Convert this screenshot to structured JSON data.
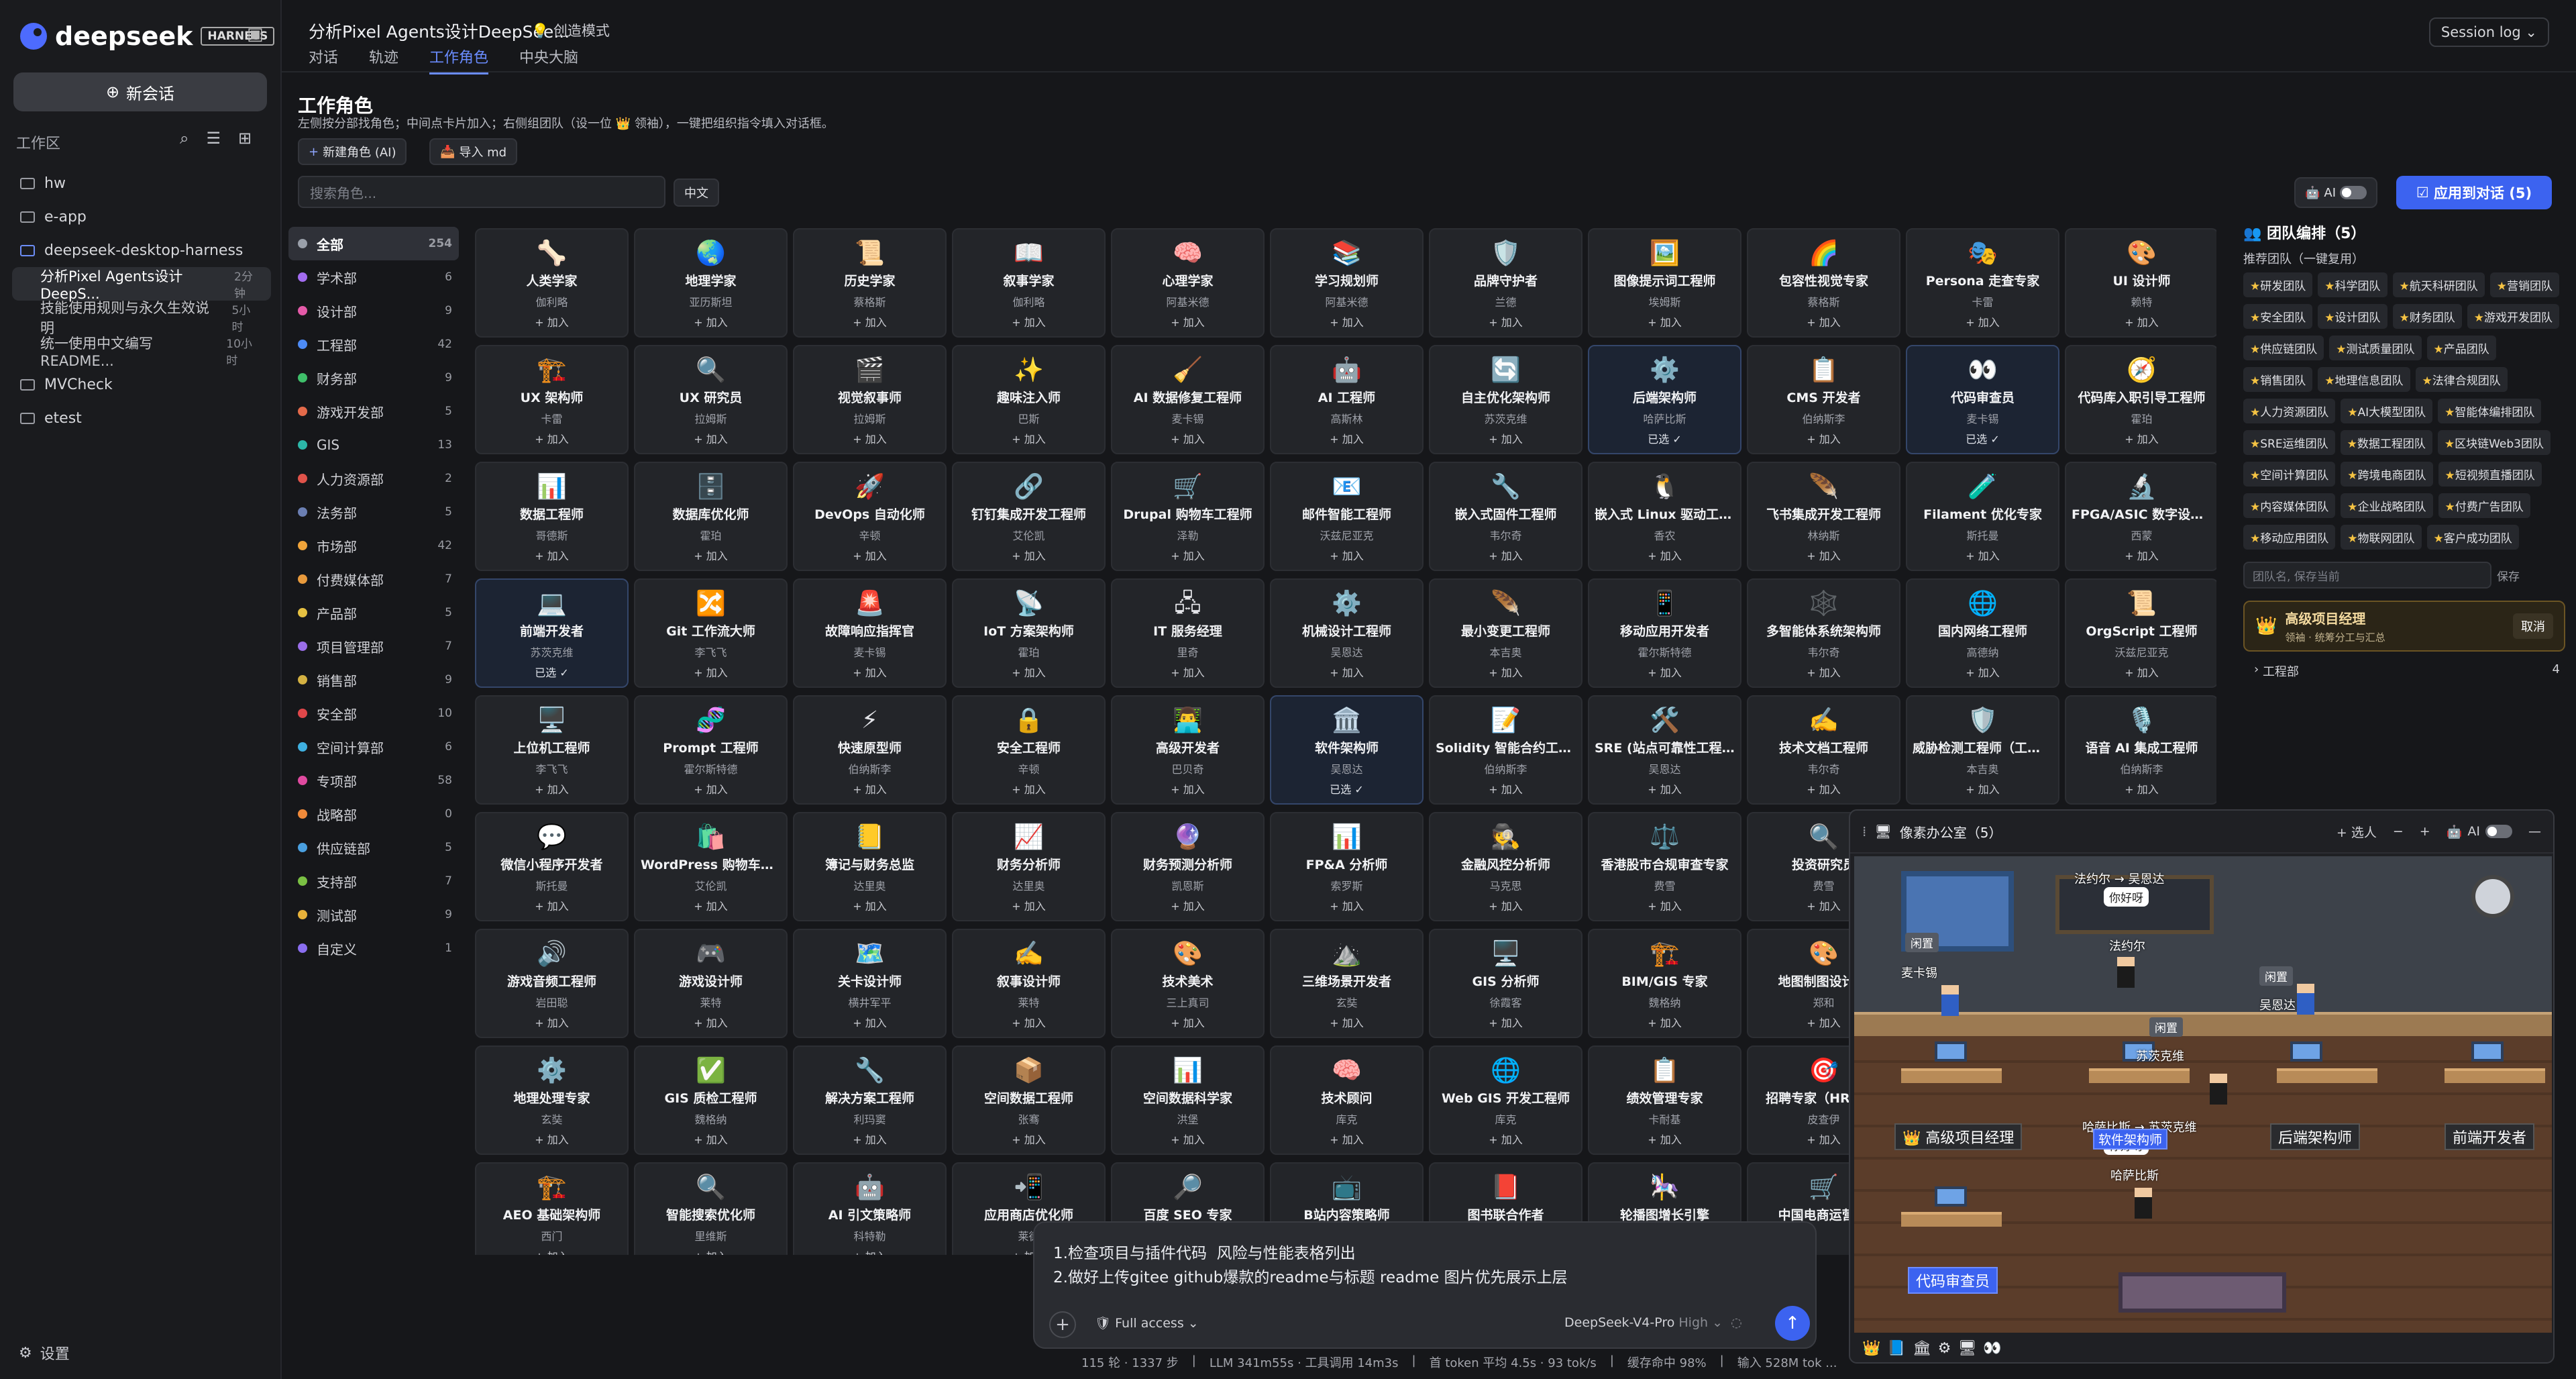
{
  "sidebar": {
    "brand": "deepseek",
    "badge": "HARNESS",
    "new_chat": "新会话",
    "workspace_label": "工作区",
    "tree": [
      {
        "label": "hw",
        "type": "folder"
      },
      {
        "label": "e-app",
        "type": "folder"
      },
      {
        "label": "deepseek-desktop-harness",
        "type": "folder-open"
      },
      {
        "label": "分析Pixel Agents设计DeepS...",
        "age": "2分钟",
        "type": "child",
        "active": true
      },
      {
        "label": "技能使用规则与永久生效说明",
        "age": "5小时",
        "type": "child"
      },
      {
        "label": "统一使用中文编写README...",
        "age": "10小时",
        "type": "child"
      },
      {
        "label": "MVCheck",
        "type": "folder"
      },
      {
        "label": "etest",
        "type": "folder"
      }
    ],
    "settings": "设置"
  },
  "header": {
    "title": "分析Pixel Agents设计DeepSee...",
    "mode": "创造模式",
    "session": "Session log",
    "tabs": [
      {
        "label": "对话"
      },
      {
        "label": "轨迹"
      },
      {
        "label": "工作角色",
        "active": true
      },
      {
        "label": "中央大脑"
      }
    ]
  },
  "page": {
    "title": "工作角色",
    "subtitle": "左侧按分部找角色；中间点卡片加入；右侧组团队（设一位 👑 领袖），一键把组织指令填入对话框。",
    "new_role": "新建角色 (AI)",
    "import": "导入 md",
    "search_placeholder": "搜索角色...",
    "lang": "中文",
    "ai": "AI",
    "apply": "应用到对话 (5)"
  },
  "departments": [
    {
      "label": "全部",
      "count": "254",
      "color": "#9aa0aa",
      "active": true
    },
    {
      "label": "学术部",
      "count": "6",
      "color": "#a36cf0"
    },
    {
      "label": "设计部",
      "count": "9",
      "color": "#e45aa8"
    },
    {
      "label": "工程部",
      "count": "42",
      "color": "#4d8bf5"
    },
    {
      "label": "财务部",
      "count": "9",
      "color": "#3fbf6a"
    },
    {
      "label": "游戏开发部",
      "count": "5",
      "color": "#e46a4a"
    },
    {
      "label": "GIS",
      "count": "13",
      "color": "#2cb7a8"
    },
    {
      "label": "人力资源部",
      "count": "2",
      "color": "#e0534a"
    },
    {
      "label": "法务部",
      "count": "5",
      "color": "#6b7fb3"
    },
    {
      "label": "市场部",
      "count": "42",
      "color": "#f0a43a"
    },
    {
      "label": "付费媒体部",
      "count": "7",
      "color": "#e89a3c"
    },
    {
      "label": "产品部",
      "count": "5",
      "color": "#e6c142"
    },
    {
      "label": "项目管理部",
      "count": "7",
      "color": "#9a6ee8"
    },
    {
      "label": "销售部",
      "count": "9",
      "color": "#d4b142"
    },
    {
      "label": "安全部",
      "count": "10",
      "color": "#e0474a"
    },
    {
      "label": "空间计算部",
      "count": "6",
      "color": "#3fb0e0"
    },
    {
      "label": "专项部",
      "count": "58",
      "color": "#e04aa0"
    },
    {
      "label": "战略部",
      "count": "0",
      "color": "#f08a3a"
    },
    {
      "label": "供应链部",
      "count": "5",
      "color": "#4aa0e0"
    },
    {
      "label": "支持部",
      "count": "7",
      "color": "#7ac043"
    },
    {
      "label": "测试部",
      "count": "9",
      "color": "#e8b23a"
    },
    {
      "label": "自定义",
      "count": "1",
      "color": "#8a6ef0"
    }
  ],
  "cards": [
    {
      "icon": "🦴",
      "name": "人类学家",
      "person": "伽利略",
      "add": "+ 加入"
    },
    {
      "icon": "🌏",
      "name": "地理学家",
      "person": "亚历斯坦",
      "add": "+ 加入"
    },
    {
      "icon": "📜",
      "name": "历史学家",
      "person": "蔡格斯",
      "add": "+ 加入"
    },
    {
      "icon": "📖",
      "name": "叙事学家",
      "person": "伽利略",
      "add": "+ 加入"
    },
    {
      "icon": "🧠",
      "name": "心理学家",
      "person": "阿基米德",
      "add": "+ 加入"
    },
    {
      "icon": "📚",
      "name": "学习规划师",
      "person": "阿基米德",
      "add": "+ 加入"
    },
    {
      "icon": "🛡️",
      "name": "品牌守护者",
      "person": "兰德",
      "add": "+ 加入"
    },
    {
      "icon": "🖼️",
      "name": "图像提示词工程师",
      "person": "埃姆斯",
      "add": "+ 加入"
    },
    {
      "icon": "🌈",
      "name": "包容性视觉专家",
      "person": "蔡格斯",
      "add": "+ 加入"
    },
    {
      "icon": "🎭",
      "name": "Persona 走查专家",
      "person": "卡雷",
      "add": "+ 加入"
    },
    {
      "icon": "🎨",
      "name": "UI 设计师",
      "person": "赖特",
      "add": "+ 加入"
    },
    {
      "icon": "🏗️",
      "name": "UX 架构师",
      "person": "卡雷",
      "add": "+ 加入"
    },
    {
      "icon": "🔍",
      "name": "UX 研究员",
      "person": "拉姆斯",
      "add": "+ 加入"
    },
    {
      "icon": "🎬",
      "name": "视觉叙事师",
      "person": "拉姆斯",
      "add": "+ 加入"
    },
    {
      "icon": "✨",
      "name": "趣味注入师",
      "person": "巴斯",
      "add": "+ 加入"
    },
    {
      "icon": "🧹",
      "name": "AI 数据修复工程师",
      "person": "麦卡锡",
      "add": "+ 加入"
    },
    {
      "icon": "🤖",
      "name": "AI 工程师",
      "person": "高斯林",
      "add": "+ 加入"
    },
    {
      "icon": "🔄",
      "name": "自主优化架构师",
      "person": "苏茨克维",
      "add": "+ 加入"
    },
    {
      "icon": "⚙️",
      "name": "后端架构师",
      "person": "哈萨比斯",
      "add": "已选 ✓",
      "sel": true
    },
    {
      "icon": "📋",
      "name": "CMS 开发者",
      "person": "伯纳斯李",
      "add": "+ 加入"
    },
    {
      "icon": "👀",
      "name": "代码审查员",
      "person": "麦卡锡",
      "add": "已选 ✓",
      "sel": true
    },
    {
      "icon": "🧭",
      "name": "代码库入职引导工程师",
      "person": "霍珀",
      "add": "+ 加入"
    },
    {
      "icon": "📊",
      "name": "数据工程师",
      "person": "哥德斯",
      "add": "+ 加入"
    },
    {
      "icon": "🗄️",
      "name": "数据库优化师",
      "person": "霍珀",
      "add": "+ 加入"
    },
    {
      "icon": "🚀",
      "name": "DevOps 自动化师",
      "person": "辛顿",
      "add": "+ 加入"
    },
    {
      "icon": "🔗",
      "name": "钉钉集成开发工程师",
      "person": "艾伦凯",
      "add": "+ 加入"
    },
    {
      "icon": "🛒",
      "name": "Drupal 购物车工程师",
      "person": "泽勒",
      "add": "+ 加入"
    },
    {
      "icon": "📧",
      "name": "邮件智能工程师",
      "person": "沃兹尼亚克",
      "add": "+ 加入"
    },
    {
      "icon": "🔧",
      "name": "嵌入式固件工程师",
      "person": "韦尔奇",
      "add": "+ 加入"
    },
    {
      "icon": "🐧",
      "name": "嵌入式 Linux 驱动工程师",
      "person": "香农",
      "add": "+ 加入"
    },
    {
      "icon": "🪶",
      "name": "飞书集成开发工程师",
      "person": "林纳斯",
      "add": "+ 加入"
    },
    {
      "icon": "🧪",
      "name": "Filament 优化专家",
      "person": "斯托曼",
      "add": "+ 加入"
    },
    {
      "icon": "🔬",
      "name": "FPGA/ASIC 数字设计...",
      "person": "西蒙",
      "add": "+ 加入"
    },
    {
      "icon": "💻",
      "name": "前端开发者",
      "person": "苏茨克维",
      "add": "已选 ✓",
      "sel": true
    },
    {
      "icon": "🔀",
      "name": "Git 工作流大师",
      "person": "李飞飞",
      "add": "+ 加入"
    },
    {
      "icon": "🚨",
      "name": "故障响应指挥官",
      "person": "麦卡锡",
      "add": "+ 加入"
    },
    {
      "icon": "📡",
      "name": "IoT 方案架构师",
      "person": "霍珀",
      "add": "+ 加入"
    },
    {
      "icon": "🖧",
      "name": "IT 服务经理",
      "person": "里奇",
      "add": "+ 加入"
    },
    {
      "icon": "⚙️",
      "name": "机械设计工程师",
      "person": "吴恩达",
      "add": "+ 加入"
    },
    {
      "icon": "🪶",
      "name": "最小变更工程师",
      "person": "本吉奥",
      "add": "+ 加入"
    },
    {
      "icon": "📱",
      "name": "移动应用开发者",
      "person": "霍尔斯特德",
      "add": "+ 加入"
    },
    {
      "icon": "🕸️",
      "name": "多智能体系统架构师",
      "person": "韦尔奇",
      "add": "+ 加入"
    },
    {
      "icon": "🌐",
      "name": "国内网络工程师",
      "person": "高德纳",
      "add": "+ 加入"
    },
    {
      "icon": "📜",
      "name": "OrgScript 工程师",
      "person": "沃兹尼亚克",
      "add": "+ 加入"
    },
    {
      "icon": "🖥️",
      "name": "上位机工程师",
      "person": "李飞飞",
      "add": "+ 加入"
    },
    {
      "icon": "🧬",
      "name": "Prompt 工程师",
      "person": "霍尔斯特德",
      "add": "+ 加入"
    },
    {
      "icon": "⚡",
      "name": "快速原型师",
      "person": "伯纳斯李",
      "add": "+ 加入"
    },
    {
      "icon": "🔒",
      "name": "安全工程师",
      "person": "辛顿",
      "add": "+ 加入"
    },
    {
      "icon": "👨‍💻",
      "name": "高级开发者",
      "person": "巴贝奇",
      "add": "+ 加入"
    },
    {
      "icon": "🏛️",
      "name": "软件架构师",
      "person": "吴恩达",
      "add": "已选 ✓",
      "sel": true
    },
    {
      "icon": "📝",
      "name": "Solidity 智能合约工程师",
      "person": "伯纳斯李",
      "add": "+ 加入"
    },
    {
      "icon": "🛠️",
      "name": "SRE (站点可靠性工程师)",
      "person": "吴恩达",
      "add": "+ 加入"
    },
    {
      "icon": "✍️",
      "name": "技术文档工程师",
      "person": "韦尔奇",
      "add": "+ 加入"
    },
    {
      "icon": "🛡️",
      "name": "威胁检测工程师（工程...",
      "person": "本吉奥",
      "add": "+ 加入"
    },
    {
      "icon": "🎙️",
      "name": "语音 AI 集成工程师",
      "person": "伯纳斯李",
      "add": "+ 加入"
    },
    {
      "icon": "💬",
      "name": "微信小程序开发者",
      "person": "斯托曼",
      "add": "+ 加入"
    },
    {
      "icon": "🛍️",
      "name": "WordPress 购物车工程...",
      "person": "艾伦凯",
      "add": "+ 加入"
    },
    {
      "icon": "📒",
      "name": "簿记与财务总监",
      "person": "达里奥",
      "add": "+ 加入"
    },
    {
      "icon": "📈",
      "name": "财务分析师",
      "person": "达里奥",
      "add": "+ 加入"
    },
    {
      "icon": "🔮",
      "name": "财务预测分析师",
      "person": "凯恩斯",
      "add": "+ 加入"
    },
    {
      "icon": "📊",
      "name": "FP&A 分析师",
      "person": "索罗斯",
      "add": "+ 加入"
    },
    {
      "icon": "🕵️",
      "name": "金融风控分析师",
      "person": "马克思",
      "add": "+ 加入"
    },
    {
      "icon": "⚖️",
      "name": "香港股市合规审查专家",
      "person": "费雪",
      "add": "+ 加入"
    },
    {
      "icon": "🔍",
      "name": "投资研究员",
      "person": "费雪",
      "add": "+ 加入"
    },
    {
      "icon": "",
      "name": "",
      "person": "",
      "add": ""
    },
    {
      "icon": "",
      "name": "",
      "person": "",
      "add": ""
    },
    {
      "icon": "🔊",
      "name": "游戏音频工程师",
      "person": "岩田聪",
      "add": "+ 加入"
    },
    {
      "icon": "🎮",
      "name": "游戏设计师",
      "person": "莱特",
      "add": "+ 加入"
    },
    {
      "icon": "🗺️",
      "name": "关卡设计师",
      "person": "横井军平",
      "add": "+ 加入"
    },
    {
      "icon": "✍️",
      "name": "叙事设计师",
      "person": "莱特",
      "add": "+ 加入"
    },
    {
      "icon": "🎨",
      "name": "技术美术",
      "person": "三上真司",
      "add": "+ 加入"
    },
    {
      "icon": "⛰️",
      "name": "三维场景开发者",
      "person": "玄奘",
      "add": "+ 加入"
    },
    {
      "icon": "🖥️",
      "name": "GIS 分析师",
      "person": "徐霞客",
      "add": "+ 加入"
    },
    {
      "icon": "🏗️",
      "name": "BIM/GIS 专家",
      "person": "魏格纳",
      "add": "+ 加入"
    },
    {
      "icon": "🎨",
      "name": "地图制图设计...",
      "person": "郑和",
      "add": "+ 加入"
    },
    {
      "icon": "",
      "name": "",
      "person": "",
      "add": ""
    },
    {
      "icon": "",
      "name": "",
      "person": "",
      "add": ""
    },
    {
      "icon": "⚙️",
      "name": "地理处理专家",
      "person": "玄奘",
      "add": "+ 加入"
    },
    {
      "icon": "✅",
      "name": "GIS 质检工程师",
      "person": "魏格纳",
      "add": "+ 加入"
    },
    {
      "icon": "🔧",
      "name": "解决方案工程师",
      "person": "利玛窦",
      "add": "+ 加入"
    },
    {
      "icon": "📦",
      "name": "空间数据工程师",
      "person": "张骞",
      "add": "+ 加入"
    },
    {
      "icon": "📊",
      "name": "空间数据科学家",
      "person": "洪堡",
      "add": "+ 加入"
    },
    {
      "icon": "🧠",
      "name": "技术顾问",
      "person": "库克",
      "add": "+ 加入"
    },
    {
      "icon": "🌐",
      "name": "Web GIS 开发工程师",
      "person": "库克",
      "add": "+ 加入"
    },
    {
      "icon": "📋",
      "name": "绩效管理专家",
      "person": "卡耐基",
      "add": "+ 加入"
    },
    {
      "icon": "🎯",
      "name": "招聘专家（HR 全...",
      "person": "皮查伊",
      "add": "+ 加入"
    },
    {
      "icon": "",
      "name": "",
      "person": "",
      "add": ""
    },
    {
      "icon": "",
      "name": "",
      "person": "",
      "add": ""
    },
    {
      "icon": "🏗️",
      "name": "AEO 基础架构师",
      "person": "西门",
      "add": "+ 加入"
    },
    {
      "icon": "🔍",
      "name": "智能搜索优化师",
      "person": "里维斯",
      "add": "+ 加入"
    },
    {
      "icon": "🤖",
      "name": "AI 引文策略师",
      "person": "科特勒",
      "add": "+ 加入"
    },
    {
      "icon": "📲",
      "name": "应用商店优化师",
      "person": "莱德",
      "add": "+ 加入"
    },
    {
      "icon": "🔎",
      "name": "百度 SEO 专家",
      "person": "",
      "add": ""
    },
    {
      "icon": "📺",
      "name": "B站内容策略师",
      "person": "",
      "add": ""
    },
    {
      "icon": "📕",
      "name": "图书联合作者",
      "person": "",
      "add": ""
    },
    {
      "icon": "🎠",
      "name": "轮播图增长引擎",
      "person": "",
      "add": ""
    },
    {
      "icon": "🛒",
      "name": "中国电商运营...",
      "person": "",
      "add": ""
    }
  ],
  "team": {
    "title": "团队编排（5）",
    "recommend": "推荐团队（一键复用）",
    "tags": [
      "研发团队",
      "科学团队",
      "航天科研团队",
      "营销团队",
      "安全团队",
      "设计团队",
      "财务团队",
      "游戏开发团队",
      "供应链团队",
      "测试质量团队",
      "产品团队",
      "销售团队",
      "地理信息团队",
      "法律合规团队",
      "人力资源团队",
      "AI大模型团队",
      "智能体编排团队",
      "SRE运维团队",
      "数据工程团队",
      "区块链Web3团队",
      "空间计算团队",
      "跨境电商团队",
      "短视频直播团队",
      "内容媒体团队",
      "企业战略团队",
      "付费广告团队",
      "移动应用团队",
      "物联网团队",
      "客户成功团队"
    ],
    "name_placeholder": "团队名, 保存当前",
    "save": "保存",
    "lead_title": "高级项目经理",
    "lead_sub": "领袖 · 统筹分工与汇总",
    "cancel": "取消",
    "eng_label": "工程部",
    "eng_count": "4"
  },
  "office": {
    "title": "像素办公室（5）",
    "add": "+ 选人",
    "minus": "−",
    "plus": "+",
    "ai": "AI",
    "close": "—",
    "bubbles": [
      "你好呀",
      "你好呀"
    ],
    "idle": [
      "闲置",
      "闲置",
      "闲置"
    ],
    "labels": [
      "法约尔 → 吴恩达",
      "麦卡锡",
      "法约尔",
      "吴恩达",
      "苏茨克维",
      "哈萨比斯 → 苏茨克维",
      "哈萨比斯"
    ],
    "plates": [
      "高级项目经理",
      "后端架构师",
      "前端开发者",
      "代码审查员",
      "软件架构师"
    ]
  },
  "chat": {
    "text": "1.检查项目与插件代码  风险与性能表格列出\n2.做好上传gitee github爆款的readme与标题 readme 图片优先展示上层",
    "access": "Full access",
    "model": "DeepSeek-V4-Pro",
    "level": "High"
  },
  "status": [
    "115 轮 · 1337 步",
    "LLM 341m55s · 工具调用 14m3s",
    "首 token 平均 4.5s · 93 tok/s",
    "缓存命中 98%",
    "输入 528M tok ..."
  ]
}
